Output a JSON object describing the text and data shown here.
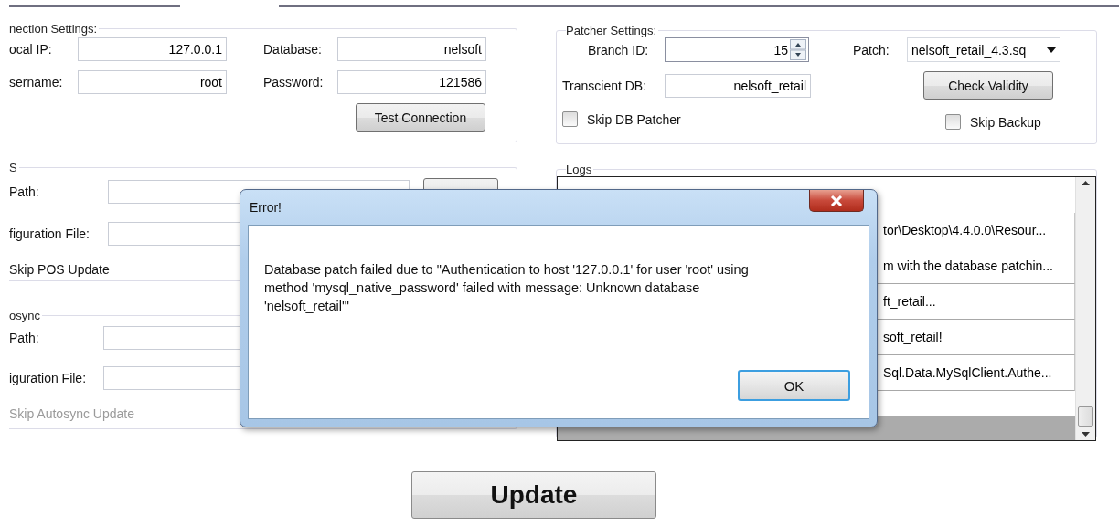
{
  "connection": {
    "title": "nection Settings:",
    "fields": [
      {
        "label": "ocal IP:",
        "value": "127.0.0.1"
      },
      {
        "label": "Database:",
        "value": "nelsoft"
      },
      {
        "label": "sername:",
        "value": "root"
      },
      {
        "label": "Password:",
        "value": "121586"
      }
    ],
    "button": "Test Connection"
  },
  "patcher": {
    "title": "Patcher Settings:",
    "branch_id": {
      "label": "Branch ID:",
      "value": "15"
    },
    "patch": {
      "label": "Patch:",
      "value": "nelsoft_retail_4.3.sq"
    },
    "transcient_db": {
      "label": "Transcient DB:",
      "value": "nelsoft_retail"
    },
    "check_button": "Check Validity",
    "skip_db_patcher": {
      "label": "Skip DB Patcher",
      "checked": false
    },
    "skip_backup": {
      "label": "Skip Backup",
      "checked": false
    }
  },
  "pos": {
    "title": "S",
    "path_label": "Path:",
    "config_label": "figuration File:",
    "skip_label": "Skip POS Update",
    "disabled": false
  },
  "autosync": {
    "title": "osync",
    "path_label": "Path:",
    "config_label": "iguration File:",
    "skip_label": "Skip Autosync Update",
    "disabled": true
  },
  "logs": {
    "title": "Logs",
    "rows": [
      "tor\\Desktop\\4.4.0.0\\Resour...",
      "m with the database patchin...",
      "ft_retail...",
      "soft_retail!",
      "Sql.Data.MySqlClient.Authe..."
    ]
  },
  "dialog": {
    "title": "Error!",
    "message": "Database patch failed due to \"Authentication to host '127.0.0.1' for user 'root' using method 'mysql_native_password' failed with message: Unknown database 'nelsoft_retail'\"",
    "ok": "OK"
  },
  "update_button": "Update"
}
